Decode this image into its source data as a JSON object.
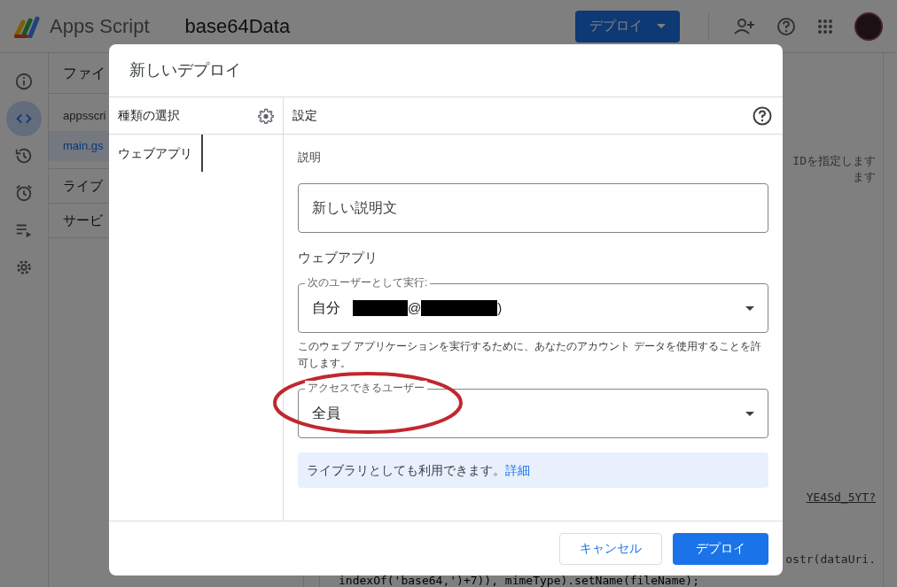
{
  "app_bar": {
    "product": "Apps Script",
    "project": "base64Data",
    "deploy_button": "デプロイ"
  },
  "rail": [
    {
      "selected": false
    },
    {
      "selected": true
    },
    {
      "selected": false
    },
    {
      "selected": false
    },
    {
      "selected": false
    },
    {
      "selected": false
    }
  ],
  "files_panel": {
    "header": "ファイ",
    "items": [
      {
        "label": "appsscri",
        "selected": false
      },
      {
        "label": "main.gs",
        "selected": true
      }
    ],
    "sections": [
      "ライブ",
      "サービ"
    ]
  },
  "editor": {
    "lines": [
      {
        "kind": "comment",
        "text": "IDを指定します"
      },
      {
        "kind": "comment",
        "text": "ます"
      },
      {
        "kind": "link",
        "text": "YE4Sd_5YT?"
      },
      {
        "kind": "code",
        "text": "ostr(dataUri."
      },
      {
        "kind": "code",
        "text": "indexOf('base64,')+7)), mimeType).setName(fileName);"
      }
    ]
  },
  "dialog": {
    "title": "新しいデプロイ",
    "type_panel": {
      "header": "種類の選択",
      "items": [
        {
          "label": "ウェブアプリ",
          "selected": true
        }
      ]
    },
    "settings": {
      "header": "設定",
      "description_label": "説明",
      "description_placeholder": "新しい説明文",
      "section": "ウェブアプリ",
      "execute_as": {
        "label": "次のユーザーとして実行:",
        "value": "自分",
        "email_parts": [
          "@",
          ")"
        ]
      },
      "permission_note": "このウェブ アプリケーションを実行するために、あなたのアカウント データを使用することを許可します。",
      "access": {
        "label": "アクセスできるユーザー",
        "value": "全員",
        "circled": true
      },
      "info": {
        "text": "ライブラリとしても利用できます。",
        "link": "詳細"
      }
    },
    "buttons": [
      {
        "label": "キャンセル",
        "kind": "secondary"
      },
      {
        "label": "デプロイ",
        "kind": "primary"
      }
    ]
  }
}
